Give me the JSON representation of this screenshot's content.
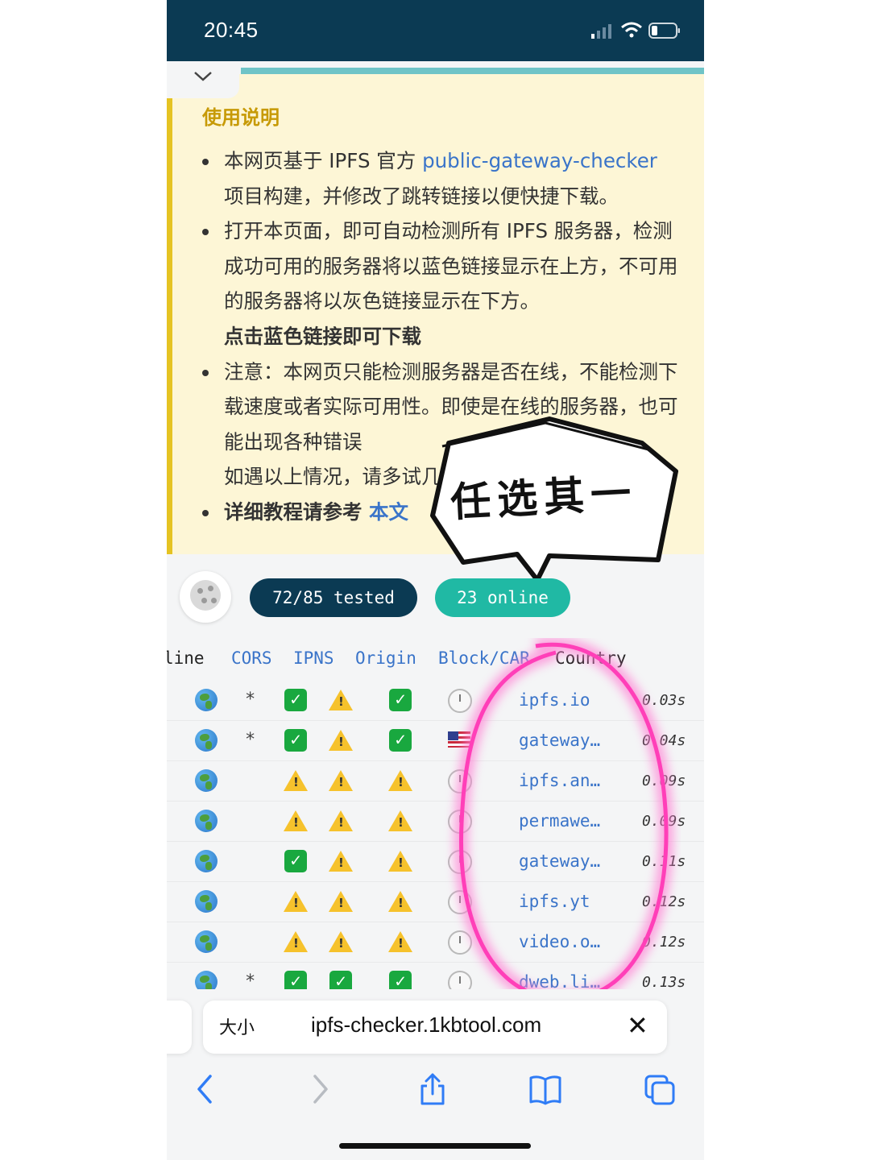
{
  "status": {
    "time": "20:45"
  },
  "notice": {
    "title": "使用说明",
    "item1_text": "本网页基于 IPFS 官方 ",
    "item1_link": "public-gateway-checker",
    "item1_text2": "项目构建，并修改了跳转链接以便快捷下载。",
    "item2_text": "打开本页面，即可自动检测所有 IPFS 服务器，检测成功可用的服务器将以蓝色链接显示在上方，不可用的服务器将以灰色链接显示在下方。",
    "item2_bold": "点击蓝色链接即可下载",
    "item3_text": "注意：本网页只能检测服务器是否在线，不能检测下载速度或者实际可用性。即使是在线的服务器，也可能出现各种错误",
    "item3_text2": "如遇以上情况，请多试几",
    "item4_bold": "详细教程请参考 ",
    "item4_link": "本文"
  },
  "bubble": {
    "text": "任选其一"
  },
  "stats": {
    "tested": "72/85 tested",
    "online": "23 online"
  },
  "table": {
    "headers": [
      "line",
      "CORS",
      "IPNS",
      "Origin",
      "Block/CAR",
      "Country"
    ],
    "rows": [
      {
        "hostname": "ipfs.io",
        "latency": "0.03s"
      },
      {
        "hostname": "gateway…",
        "latency": "0.04s"
      },
      {
        "hostname": "ipfs.an…",
        "latency": "0.09s"
      },
      {
        "hostname": "permawe…",
        "latency": "0.09s"
      },
      {
        "hostname": "gateway…",
        "latency": "0.11s"
      },
      {
        "hostname": "ipfs.yt",
        "latency": "0.12s"
      },
      {
        "hostname": "video.o…",
        "latency": "0.12s"
      },
      {
        "hostname": "dweb.li…",
        "latency": "0.13s"
      }
    ]
  },
  "browser": {
    "size_label": "大小",
    "url": "ipfs-checker.1kbtool.com",
    "close_label": "✕"
  },
  "icons": {
    "collapse": "chevron-down-icon",
    "online": "globe-icon",
    "ok": "check-icon",
    "warning": "warning-icon",
    "pending": "clock-icon",
    "country_us": "us-flag-icon"
  },
  "colors": {
    "status_bar": "#0b3a53",
    "notice_bg": "#fdf6d6",
    "notice_accent": "#e5c322",
    "link": "#3a74c9",
    "online_chip": "#20b9a4",
    "highlight_circle": "#ff4fc1"
  }
}
